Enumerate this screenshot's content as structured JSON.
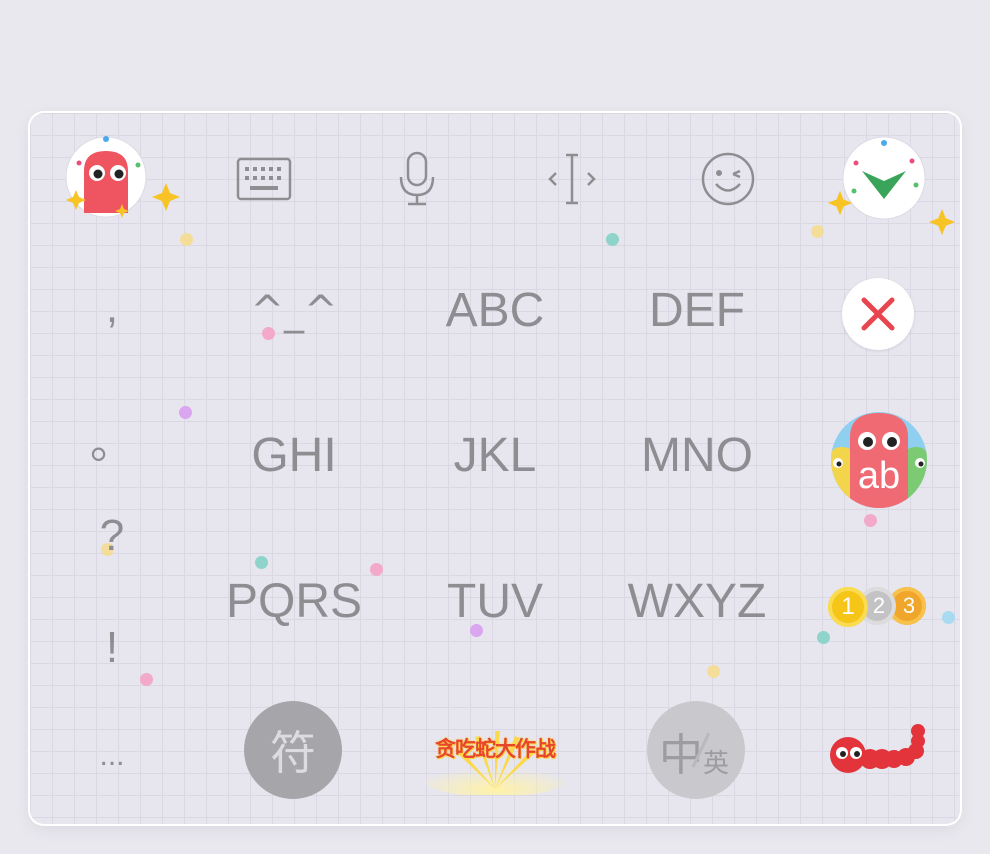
{
  "toolbar": {
    "icons": [
      "snake-mascot-icon",
      "keyboard-icon",
      "microphone-icon",
      "cursor-icon",
      "emoji-icon",
      "confirm-check-icon"
    ]
  },
  "punctuation": [
    ",",
    "。",
    "?",
    "!",
    "..."
  ],
  "keys": {
    "row1": [
      "^_^",
      "ABC",
      "DEF"
    ],
    "row2": [
      "GHI",
      "JKL",
      "MNO"
    ],
    "row3": [
      "PQRS",
      "TUV",
      "WXYZ"
    ]
  },
  "side": {
    "delete": "delete-icon",
    "case_label": "ab",
    "numbers": [
      "1",
      "2",
      "3"
    ]
  },
  "bottom": {
    "symbol_label": "符",
    "game_text": "贪吃蛇大作战",
    "lang_zh": "中",
    "lang_en": "英"
  },
  "colors": {
    "accent_red": "#e8454f",
    "check_green": "#3aa55a",
    "gold": "#f7c325",
    "key_text": "#8e8e92"
  }
}
